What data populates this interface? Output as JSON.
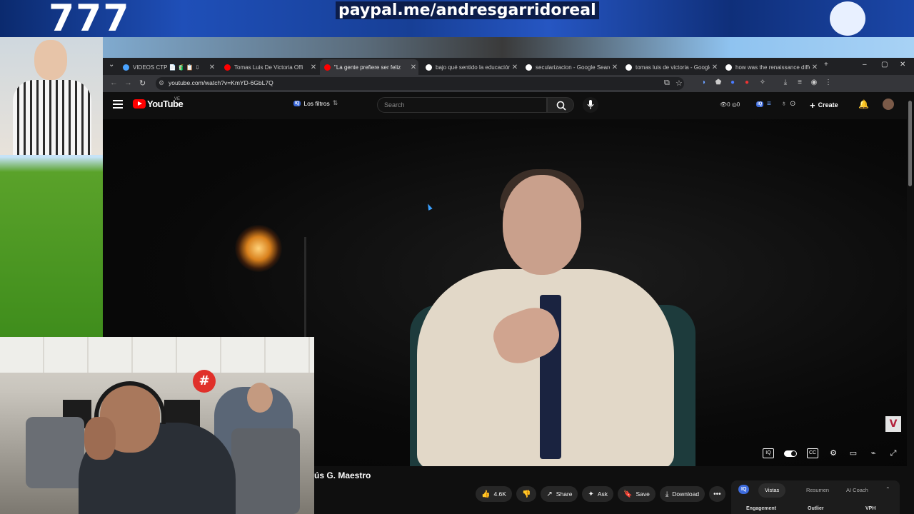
{
  "banner": {
    "number": "777",
    "url": "paypal.me/andresgarridoreal"
  },
  "browser": {
    "tabs": [
      {
        "title": "VIDEOS CTP 📄 🧃 📋 ⇩",
        "favicon_color": "#4aa3ff"
      },
      {
        "title": "Tomas Luis De Victoria Offi",
        "favicon_color": "#ff0000"
      },
      {
        "title": "\"La gente prefiere ser feliz",
        "favicon_color": "#ff0000",
        "active": true
      },
      {
        "title": "bajo qué sentido la educación",
        "favicon_color": "#ffffff"
      },
      {
        "title": "secularizacion - Google Search",
        "favicon_color": "#ffffff"
      },
      {
        "title": "tomas luis de victoria - Google",
        "favicon_color": "#ffffff"
      },
      {
        "title": "how was the renaissance differ",
        "favicon_color": "#ffffff"
      }
    ],
    "new_tab_label": "+",
    "window_controls": [
      "–",
      "▢",
      "✕"
    ],
    "address": "youtube.com/watch?v=KmYD-6GbL7Q"
  },
  "youtube": {
    "logo_text": "YouTube",
    "region": "VE",
    "filters_badge": "IQ",
    "filters_label": "Los filtros",
    "search_placeholder": "Search",
    "counts": "👁0 ◎0",
    "create_label": "Create",
    "video": {
      "channel_logo": "V",
      "title_partial": "ús G. Maestro"
    },
    "actions": [
      {
        "icon": "👍",
        "label": "4.6K"
      },
      {
        "icon": "👎",
        "label": ""
      },
      {
        "icon": "↗",
        "label": "Share"
      },
      {
        "icon": "✦",
        "label": "Ask"
      },
      {
        "icon": "🔖",
        "label": "Save"
      },
      {
        "icon": "⤓",
        "label": "Download"
      },
      {
        "icon": "•••",
        "label": ""
      }
    ],
    "panel": {
      "badge": "IQ",
      "tabs": [
        "Vistas",
        "Resumen",
        "AI Coach"
      ],
      "columns": [
        "Engagement",
        "Outlier",
        "VPH"
      ]
    }
  },
  "webcam": {
    "logo_symbol": "#"
  },
  "colors": {
    "youtube_red": "#ff0000",
    "accent_blue": "#3d6bdc"
  }
}
